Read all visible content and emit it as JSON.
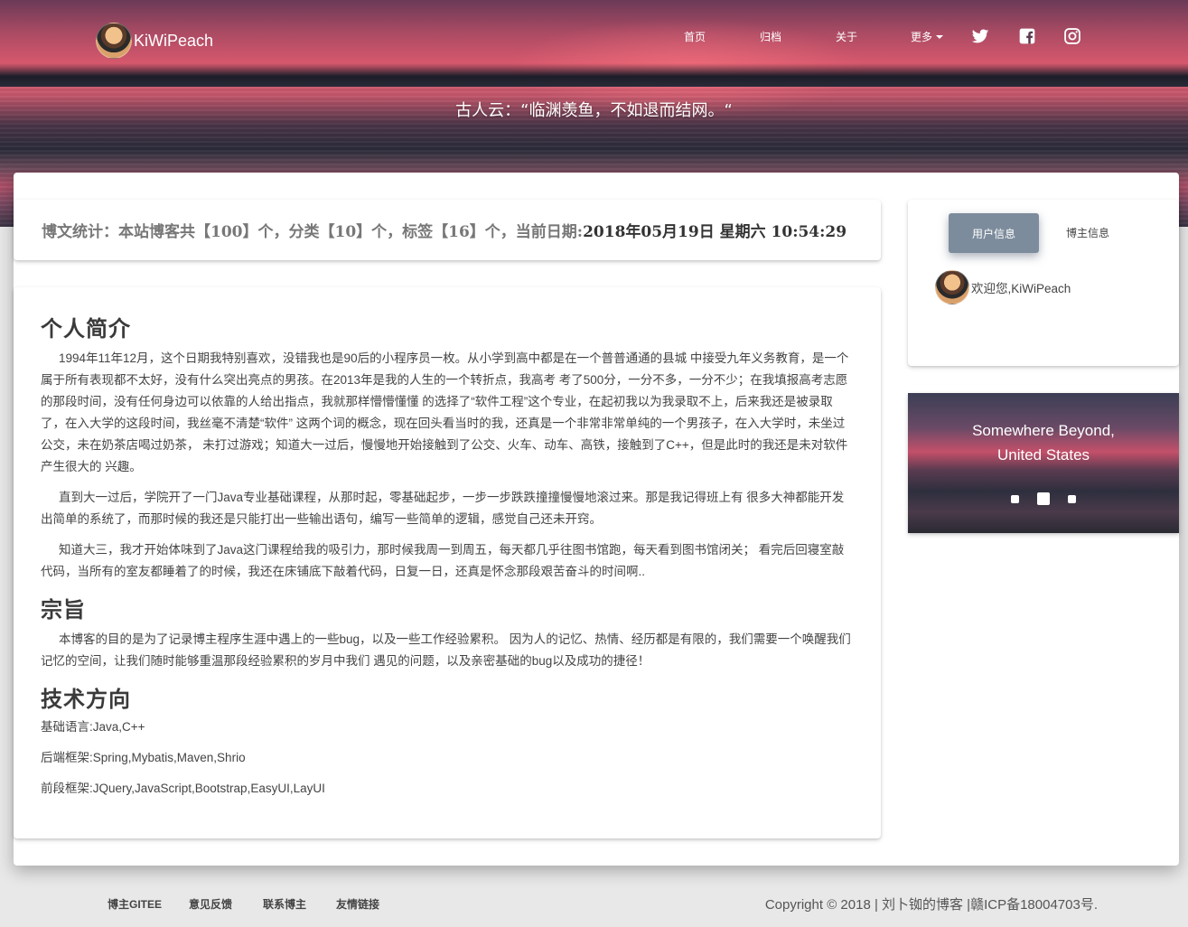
{
  "header": {
    "brand": "KiWiPeach",
    "nav": [
      {
        "label": "首页"
      },
      {
        "label": "归档"
      },
      {
        "label": "关于"
      },
      {
        "label": "更多"
      }
    ],
    "social_icons": [
      "twitter-icon",
      "facebook-icon",
      "instagram-icon"
    ],
    "quote": "古人云：“临渊羡鱼，不如退而结网。“"
  },
  "stats": {
    "label": "博文统计：本站博客共【100】个，分类【10】个，标签【16】个，当前日期:",
    "date": "2018年05月19日 星期六 10:54:29"
  },
  "intro": {
    "heading": "个人简介",
    "paragraphs": [
      "1994年11年12月，这个日期我特别喜欢，没错我也是90后的小程序员一枚。从小学到高中都是在一个普普通通的县城 中接受九年义务教育，是一个属于所有表现都不太好，没有什么突出亮点的男孩。在2013年是我的人生的一个转折点，我高考 考了500分，一分不多，一分不少；在我填报高考志愿的那段时间，没有任何身边可以依靠的人给出指点，我就那样懵懵懂懂 的选择了“软件工程”这个专业，在起初我以为我录取不上，后来我还是被录取了，在入大学的这段时间，我丝毫不清楚“软件” 这两个词的概念，现在回头看当时的我，还真是一个非常非常单纯的一个男孩子，在入大学时，未坐过公交，未在奶茶店喝过奶茶， 未打过游戏；知道大一过后，慢慢地开始接触到了公交、火车、动车、高铁，接触到了C++，但是此时的我还是未对软件产生很大的 兴趣。",
      "直到大一过后，学院开了一门Java专业基础课程，从那时起，零基础起步，一步一步跌跌撞撞慢慢地滚过来。那是我记得班上有 很多大神都能开发出简单的系统了，而那时候的我还是只能打出一些输出语句，编写一些简单的逻辑，感觉自己还未开窍。",
      "知道大三，我才开始体味到了Java这门课程给我的吸引力，那时候我周一到周五，每天都几乎往图书馆跑，每天看到图书馆闭关； 看完后回寝室敲代码，当所有的室友都睡着了的时候，我还在床铺底下敲着代码，日复一日，还真是怀念那段艰苦奋斗的时间啊.."
    ],
    "aim_heading": "宗旨",
    "aim_text": "本博客的目的是为了记录博主程序生涯中遇上的一些bug，以及一些工作经验累积。 因为人的记忆、热情、经历都是有限的，我们需要一个唤醒我们记忆的空间，让我们随时能够重温那段经验累积的岁月中我们 遇见的问题，以及亲密基础的bug以及成功的捷径！",
    "tech_heading": "技术方向",
    "tech_items": [
      "基础语言:Java,C++",
      "后端框架:Spring,Mybatis,Maven,Shrio",
      "前段框架:JQuery,JavaScript,Bootstrap,EasyUI,LayUI"
    ]
  },
  "sidebar": {
    "tabs": [
      "用户信息",
      "博主信息"
    ],
    "welcome": "欢迎您,KiWiPeach"
  },
  "carousel": {
    "caption_line1": "Somewhere Beyond,",
    "caption_line2": "United States",
    "slide_count": 3,
    "active_slide": 2
  },
  "footer": {
    "links": [
      "博主GITEE",
      "意见反馈",
      "联系博主",
      "友情链接"
    ],
    "copyright": "Copyright © 2018 | 刘卜铷的博客 |赣ICP备18004703号."
  }
}
